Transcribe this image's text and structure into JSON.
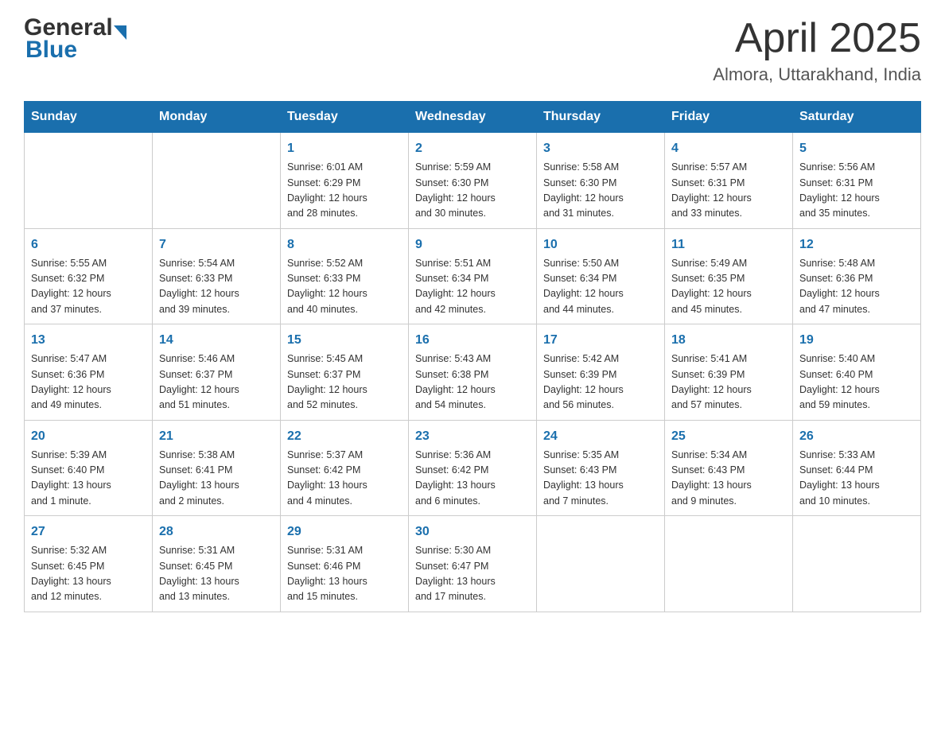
{
  "header": {
    "logo_general": "General",
    "logo_blue": "Blue",
    "title": "April 2025",
    "subtitle": "Almora, Uttarakhand, India"
  },
  "calendar": {
    "days_of_week": [
      "Sunday",
      "Monday",
      "Tuesday",
      "Wednesday",
      "Thursday",
      "Friday",
      "Saturday"
    ],
    "weeks": [
      [
        {
          "day": "",
          "info": ""
        },
        {
          "day": "",
          "info": ""
        },
        {
          "day": "1",
          "info": "Sunrise: 6:01 AM\nSunset: 6:29 PM\nDaylight: 12 hours\nand 28 minutes."
        },
        {
          "day": "2",
          "info": "Sunrise: 5:59 AM\nSunset: 6:30 PM\nDaylight: 12 hours\nand 30 minutes."
        },
        {
          "day": "3",
          "info": "Sunrise: 5:58 AM\nSunset: 6:30 PM\nDaylight: 12 hours\nand 31 minutes."
        },
        {
          "day": "4",
          "info": "Sunrise: 5:57 AM\nSunset: 6:31 PM\nDaylight: 12 hours\nand 33 minutes."
        },
        {
          "day": "5",
          "info": "Sunrise: 5:56 AM\nSunset: 6:31 PM\nDaylight: 12 hours\nand 35 minutes."
        }
      ],
      [
        {
          "day": "6",
          "info": "Sunrise: 5:55 AM\nSunset: 6:32 PM\nDaylight: 12 hours\nand 37 minutes."
        },
        {
          "day": "7",
          "info": "Sunrise: 5:54 AM\nSunset: 6:33 PM\nDaylight: 12 hours\nand 39 minutes."
        },
        {
          "day": "8",
          "info": "Sunrise: 5:52 AM\nSunset: 6:33 PM\nDaylight: 12 hours\nand 40 minutes."
        },
        {
          "day": "9",
          "info": "Sunrise: 5:51 AM\nSunset: 6:34 PM\nDaylight: 12 hours\nand 42 minutes."
        },
        {
          "day": "10",
          "info": "Sunrise: 5:50 AM\nSunset: 6:34 PM\nDaylight: 12 hours\nand 44 minutes."
        },
        {
          "day": "11",
          "info": "Sunrise: 5:49 AM\nSunset: 6:35 PM\nDaylight: 12 hours\nand 45 minutes."
        },
        {
          "day": "12",
          "info": "Sunrise: 5:48 AM\nSunset: 6:36 PM\nDaylight: 12 hours\nand 47 minutes."
        }
      ],
      [
        {
          "day": "13",
          "info": "Sunrise: 5:47 AM\nSunset: 6:36 PM\nDaylight: 12 hours\nand 49 minutes."
        },
        {
          "day": "14",
          "info": "Sunrise: 5:46 AM\nSunset: 6:37 PM\nDaylight: 12 hours\nand 51 minutes."
        },
        {
          "day": "15",
          "info": "Sunrise: 5:45 AM\nSunset: 6:37 PM\nDaylight: 12 hours\nand 52 minutes."
        },
        {
          "day": "16",
          "info": "Sunrise: 5:43 AM\nSunset: 6:38 PM\nDaylight: 12 hours\nand 54 minutes."
        },
        {
          "day": "17",
          "info": "Sunrise: 5:42 AM\nSunset: 6:39 PM\nDaylight: 12 hours\nand 56 minutes."
        },
        {
          "day": "18",
          "info": "Sunrise: 5:41 AM\nSunset: 6:39 PM\nDaylight: 12 hours\nand 57 minutes."
        },
        {
          "day": "19",
          "info": "Sunrise: 5:40 AM\nSunset: 6:40 PM\nDaylight: 12 hours\nand 59 minutes."
        }
      ],
      [
        {
          "day": "20",
          "info": "Sunrise: 5:39 AM\nSunset: 6:40 PM\nDaylight: 13 hours\nand 1 minute."
        },
        {
          "day": "21",
          "info": "Sunrise: 5:38 AM\nSunset: 6:41 PM\nDaylight: 13 hours\nand 2 minutes."
        },
        {
          "day": "22",
          "info": "Sunrise: 5:37 AM\nSunset: 6:42 PM\nDaylight: 13 hours\nand 4 minutes."
        },
        {
          "day": "23",
          "info": "Sunrise: 5:36 AM\nSunset: 6:42 PM\nDaylight: 13 hours\nand 6 minutes."
        },
        {
          "day": "24",
          "info": "Sunrise: 5:35 AM\nSunset: 6:43 PM\nDaylight: 13 hours\nand 7 minutes."
        },
        {
          "day": "25",
          "info": "Sunrise: 5:34 AM\nSunset: 6:43 PM\nDaylight: 13 hours\nand 9 minutes."
        },
        {
          "day": "26",
          "info": "Sunrise: 5:33 AM\nSunset: 6:44 PM\nDaylight: 13 hours\nand 10 minutes."
        }
      ],
      [
        {
          "day": "27",
          "info": "Sunrise: 5:32 AM\nSunset: 6:45 PM\nDaylight: 13 hours\nand 12 minutes."
        },
        {
          "day": "28",
          "info": "Sunrise: 5:31 AM\nSunset: 6:45 PM\nDaylight: 13 hours\nand 13 minutes."
        },
        {
          "day": "29",
          "info": "Sunrise: 5:31 AM\nSunset: 6:46 PM\nDaylight: 13 hours\nand 15 minutes."
        },
        {
          "day": "30",
          "info": "Sunrise: 5:30 AM\nSunset: 6:47 PM\nDaylight: 13 hours\nand 17 minutes."
        },
        {
          "day": "",
          "info": ""
        },
        {
          "day": "",
          "info": ""
        },
        {
          "day": "",
          "info": ""
        }
      ]
    ]
  }
}
